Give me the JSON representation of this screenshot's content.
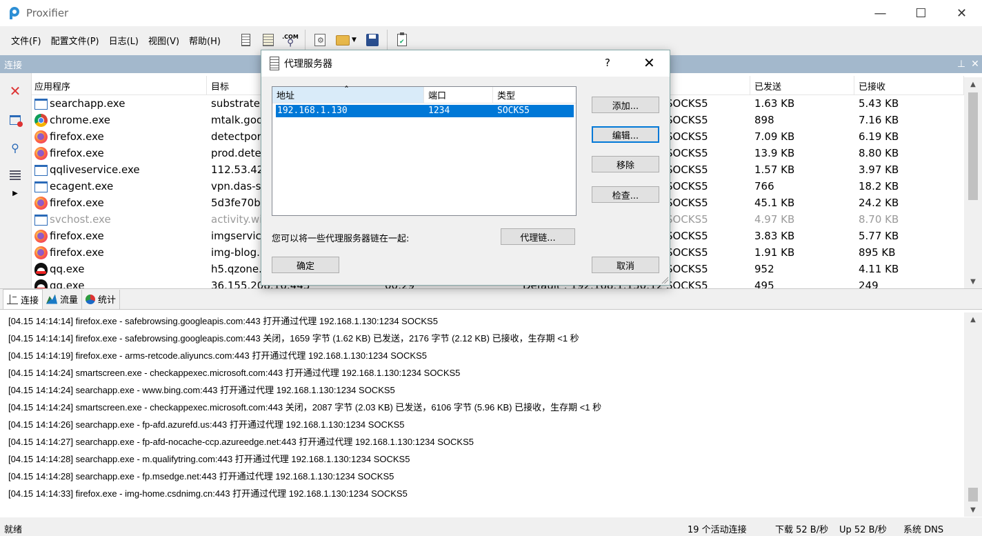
{
  "window": {
    "title": "Proxifier",
    "minimize": "—",
    "maximize": "☐",
    "close": "✕"
  },
  "menu": [
    "文件(F)",
    "配置文件(P)",
    "日志(L)",
    "视图(V)",
    "帮助(H)"
  ],
  "toolbar": {
    "com_label": ".COM"
  },
  "connections_header": {
    "title": "连接",
    "pin": "⊥",
    "close": "✕"
  },
  "table": {
    "columns": [
      "应用程序",
      "目标",
      "",
      "",
      "",
      "已发送",
      "已接收"
    ],
    "rows": [
      {
        "icon": "window",
        "app": "searchapp.exe",
        "target": "substrate.",
        "time": "",
        "rule": "",
        "proxy": "SOCKS5",
        "sent": "1.63 KB",
        "recv": "5.43 KB"
      },
      {
        "icon": "chrome",
        "app": "chrome.exe",
        "target": "mtalk.goo",
        "time": "",
        "rule": "",
        "proxy": "SOCKS5",
        "sent": "898",
        "recv": "7.16 KB"
      },
      {
        "icon": "firefox",
        "app": "firefox.exe",
        "target": "detectpor",
        "time": "",
        "rule": "",
        "proxy": "SOCKS5",
        "sent": "7.09 KB",
        "recv": "6.19 KB"
      },
      {
        "icon": "firefox",
        "app": "firefox.exe",
        "target": "prod.dete",
        "time": "",
        "rule": "",
        "proxy": "SOCKS5",
        "sent": "13.9 KB",
        "recv": "8.80 KB"
      },
      {
        "icon": "window",
        "app": "qqliveservice.exe",
        "target": "112.53.42.",
        "time": "",
        "rule": "",
        "proxy": "SOCKS5",
        "sent": "1.57 KB",
        "recv": "3.97 KB"
      },
      {
        "icon": "window",
        "app": "ecagent.exe",
        "target": "vpn.das-se",
        "time": "",
        "rule": "",
        "proxy": "SOCKS5",
        "sent": "766",
        "recv": "18.2 KB"
      },
      {
        "icon": "firefox",
        "app": "firefox.exe",
        "target": "5d3fe70ba",
        "time": "",
        "rule": "",
        "proxy": "SOCKS5",
        "sent": "45.1 KB",
        "recv": "24.2 KB"
      },
      {
        "icon": "window",
        "app": "svchost.exe",
        "target": "activity.wi",
        "time": "",
        "rule": "",
        "proxy": "SOCKS5",
        "sent": "4.97 KB",
        "recv": "8.70 KB",
        "dim": true
      },
      {
        "icon": "firefox",
        "app": "firefox.exe",
        "target": "imgservice",
        "time": "",
        "rule": "",
        "proxy": "SOCKS5",
        "sent": "3.83 KB",
        "recv": "5.77 KB"
      },
      {
        "icon": "firefox",
        "app": "firefox.exe",
        "target": "img-blog.",
        "time": "",
        "rule": "",
        "proxy": "SOCKS5",
        "sent": "1.91 KB",
        "recv": "895 KB"
      },
      {
        "icon": "qq",
        "app": "qq.exe",
        "target": "h5.qzone.",
        "time": "",
        "rule": "",
        "proxy": "SOCKS5",
        "sent": "952",
        "recv": "4.11 KB"
      },
      {
        "icon": "qq",
        "app": "qq.exe",
        "target": "36.155.208.16:443",
        "time": "00:29",
        "rule": "Default : 192.168.1.130:1234",
        "proxy": "SOCKS5",
        "sent": "495",
        "recv": "249"
      }
    ]
  },
  "tabs": [
    "连接",
    "流量",
    "统计"
  ],
  "log": [
    "[04.15 14:14:14] firefox.exe - safebrowsing.googleapis.com:443 打开通过代理 192.168.1.130:1234 SOCKS5",
    "[04.15 14:14:14] firefox.exe - safebrowsing.googleapis.com:443 关闭，1659 字节 (1.62 KB) 已发送，2176 字节 (2.12 KB) 已接收，生存期 <1 秒",
    "[04.15 14:14:19] firefox.exe - arms-retcode.aliyuncs.com:443 打开通过代理 192.168.1.130:1234 SOCKS5",
    "[04.15 14:14:24] smartscreen.exe - checkappexec.microsoft.com:443 打开通过代理 192.168.1.130:1234 SOCKS5",
    "[04.15 14:14:24] searchapp.exe - www.bing.com:443 打开通过代理 192.168.1.130:1234 SOCKS5",
    "[04.15 14:14:24] smartscreen.exe - checkappexec.microsoft.com:443 关闭，2087 字节 (2.03 KB) 已发送，6106 字节 (5.96 KB) 已接收，生存期 <1 秒",
    "[04.15 14:14:26] searchapp.exe - fp-afd.azurefd.us:443 打开通过代理 192.168.1.130:1234 SOCKS5",
    "[04.15 14:14:27] searchapp.exe - fp-afd-nocache-ccp.azureedge.net:443 打开通过代理 192.168.1.130:1234 SOCKS5",
    "[04.15 14:14:28] searchapp.exe - m.qualifytring.com:443 打开通过代理 192.168.1.130:1234 SOCKS5",
    "[04.15 14:14:28] searchapp.exe - fp.msedge.net:443 打开通过代理 192.168.1.130:1234 SOCKS5",
    "[04.15 14:14:33] firefox.exe - img-home.csdnimg.cn:443 打开通过代理 192.168.1.130:1234 SOCKS5"
  ],
  "status": {
    "ready": "就绪",
    "active": "19 个活动连接",
    "down": "下载 52 B/秒",
    "up": "Up 52 B/秒",
    "dns": "系统 DNS"
  },
  "dialog": {
    "title": "代理服务器",
    "help": "?",
    "close": "✕",
    "columns": [
      "地址",
      "端口",
      "类型"
    ],
    "sort_arrow": "ˆ",
    "row": {
      "address": "192.168.1.130",
      "port": "1234",
      "type": "SOCKS5"
    },
    "buttons": {
      "add": "添加...",
      "edit": "编辑...",
      "remove": "移除",
      "check": "检查...",
      "chain": "代理链...",
      "ok": "确定",
      "cancel": "取消"
    },
    "chain_text": "您可以将一些代理服务器链在一起:"
  },
  "colors": {
    "header_blue": "#a3b8cc",
    "selection": "#0078d7"
  }
}
